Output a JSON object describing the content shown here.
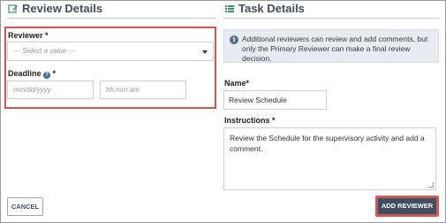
{
  "review_section": {
    "title": "Review Details",
    "reviewer_label": "Reviewer",
    "reviewer_select_placeholder": "--- Select a value ---",
    "deadline_label": "Deadline",
    "date_placeholder": "mm/dd/yyyy",
    "time_placeholder": "hh:mm am"
  },
  "task_section": {
    "title": "Task Details",
    "info_message": "Additional reviewers can review and add comments, but only the Primary Reviewer can make a final review decision.",
    "name_label": "Name",
    "name_value": "Review Schedule",
    "instructions_label": "Instructions",
    "instructions_value": "Review the Schedule for the supervisory activity and add a comment."
  },
  "required_marker": "*",
  "help_glyph": "?",
  "info_glyph": "i",
  "buttons": {
    "cancel": "CANCEL",
    "add_reviewer": "ADD REVIEWER"
  },
  "icons": {
    "review_heading": "edit-icon",
    "task_heading": "list-icon",
    "deadline_help": "help-icon",
    "info": "info-icon"
  },
  "colors": {
    "heading": "#3d4f63",
    "highlight": "#d9534f",
    "primary_button": "#3d4f63",
    "info_background": "#e6ecf1"
  }
}
